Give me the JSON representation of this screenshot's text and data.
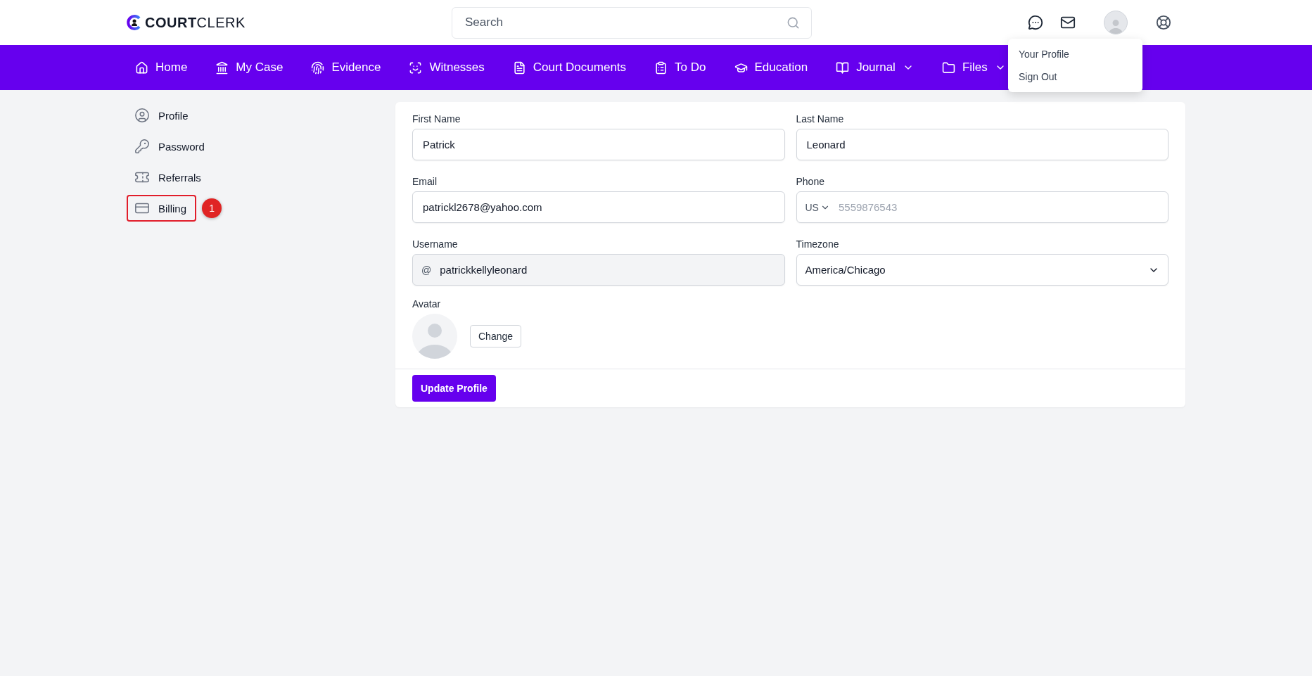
{
  "header": {
    "logo": {
      "bold": "COURT",
      "light": "CLERK"
    },
    "search": {
      "placeholder": "Search"
    }
  },
  "nav": [
    {
      "label": "Home",
      "dropdown": false
    },
    {
      "label": "My Case",
      "dropdown": false
    },
    {
      "label": "Evidence",
      "dropdown": false
    },
    {
      "label": "Witnesses",
      "dropdown": false
    },
    {
      "label": "Court Documents",
      "dropdown": false
    },
    {
      "label": "To Do",
      "dropdown": false
    },
    {
      "label": "Education",
      "dropdown": false
    },
    {
      "label": "Journal",
      "dropdown": true
    },
    {
      "label": "Files",
      "dropdown": true
    }
  ],
  "user_menu": [
    "Your Profile",
    "Sign Out"
  ],
  "sidebar": {
    "items": [
      {
        "label": "Profile",
        "highlighted": false
      },
      {
        "label": "Password",
        "highlighted": false
      },
      {
        "label": "Referrals",
        "highlighted": false
      },
      {
        "label": "Billing",
        "highlighted": true,
        "annotation": "1"
      }
    ]
  },
  "form": {
    "fields": [
      {
        "kind": "text",
        "label": "First Name",
        "value": "Patrick"
      },
      {
        "kind": "text",
        "label": "Last Name",
        "value": "Leonard"
      },
      {
        "kind": "text",
        "label": "Email",
        "value": "patrickl2678@yahoo.com"
      },
      {
        "kind": "phone",
        "label": "Phone",
        "country": "US",
        "placeholder": "5559876543"
      },
      {
        "kind": "username",
        "label": "Username",
        "prefix": "@",
        "value": "patrickkellyleonard"
      },
      {
        "kind": "select",
        "label": "Timezone",
        "value": "America/Chicago"
      }
    ],
    "avatar": {
      "label": "Avatar",
      "button": "Change"
    },
    "submit": "Update Profile"
  }
}
